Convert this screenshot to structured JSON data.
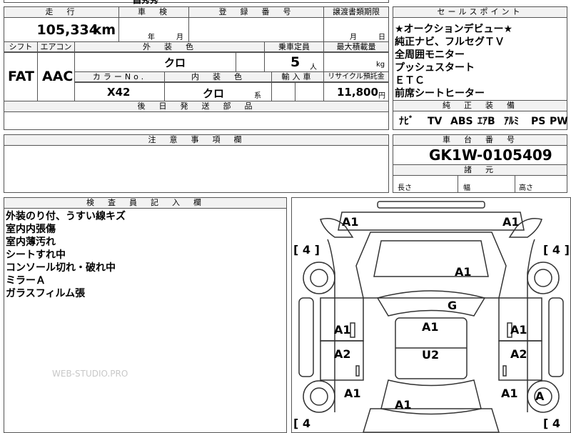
{
  "top_fragment": "昌秀秀",
  "headers": {
    "mileage": "走　行",
    "inspection": "車　検",
    "registration": "登　録　番　号",
    "transfer_deadline": "譲渡書類期限",
    "sales_point": "セールスポイント",
    "shift": "シフト",
    "aircon": "エアコン",
    "exterior_color": "外　装　色",
    "capacity": "乗車定員",
    "max_load": "最大積載量",
    "color_no": "カラーNo.",
    "interior_color": "内　装　色",
    "import": "輸入車",
    "recycle": "リサイクル預託金",
    "later_parts": "後　日　発　送　部　品",
    "equipment": "純　正　装　備",
    "notes": "注　意　事　項　欄",
    "chassis": "車　台　番　号",
    "specs": "諸　元",
    "inspector": "検　査　員　記　入　欄"
  },
  "values": {
    "mileage": "105,334",
    "mileage_unit": "km",
    "inspection_year": "年",
    "inspection_month": "月",
    "transfer_month": "月",
    "transfer_day": "日",
    "shift": "FAT",
    "aircon": "AAC",
    "exterior_color": "クロ",
    "capacity": "5",
    "capacity_unit": "人",
    "max_load_unit": "kg",
    "color_no": "X42",
    "interior_color": "クロ",
    "interior_suffix": "系",
    "recycle": "11,800",
    "recycle_unit": "円",
    "chassis_no": "GK1W-0105409",
    "length_label": "長さ",
    "width_label": "幅",
    "height_label": "高さ"
  },
  "sales_points": [
    "★オークションデビュー★",
    "純正ナビ、フルセグＴＶ",
    "全周囲モニター",
    "プッシュスタート",
    "ＥＴＣ",
    "前席シートヒーター"
  ],
  "equipment": [
    "ﾅﾋﾞ",
    "TV",
    "ABS",
    "ｴｱB",
    "ｱﾙﾐ",
    "PS",
    "PW"
  ],
  "inspector_notes": [
    "外装のり付、うすい線キズ",
    "室内内張傷",
    "室内薄汚れ",
    "シートすれ中",
    "コンソール切れ・破れ中",
    "ミラーＡ",
    "ガラスフィルム張"
  ],
  "diagram": {
    "marks": {
      "front_left": "A1",
      "front_right": "A1",
      "hood": "A1",
      "windshield": "G",
      "roof": "A1",
      "roof_lower": "U2",
      "left_front_door": "A1",
      "right_front_door": "A1",
      "left_rear_door": "A2",
      "right_rear_door": "A2",
      "left_rear_quarter": "A1",
      "right_rear_quarter": "A1",
      "rear_bumper": "A1",
      "rear_right_wheel": "A"
    },
    "tires": [
      "[ 4 ]",
      "[ 4 ]",
      "[ 4",
      "[ 4"
    ]
  },
  "watermark": "WEB-STUDIO.PRO"
}
